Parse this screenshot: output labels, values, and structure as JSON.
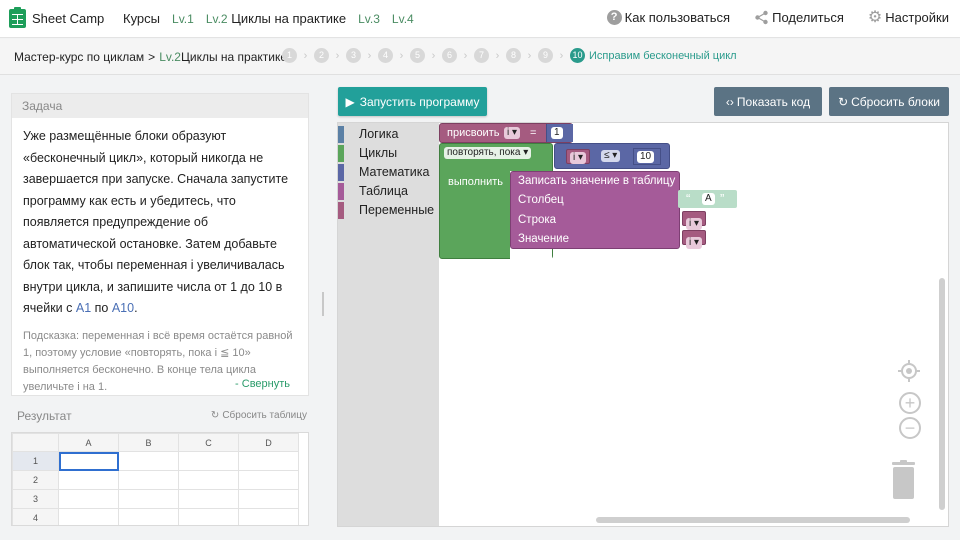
{
  "header": {
    "app_name": "Sheet Camp",
    "nav": {
      "courses": "Курсы",
      "items": [
        {
          "lv": "Lv.1",
          "label": ""
        },
        {
          "lv": "Lv.2",
          "label": "Циклы на практике"
        },
        {
          "lv": "Lv.3",
          "label": ""
        },
        {
          "lv": "Lv.4",
          "label": ""
        }
      ]
    },
    "actions": {
      "how_to": "Как пользоваться",
      "share": "Поделиться",
      "settings": "Настройки"
    }
  },
  "breadcrumb": {
    "course": "Мастер-курс по циклам",
    "separator": ">",
    "level": "Lv.2",
    "lesson": "Циклы на практике",
    "steps": [
      "1",
      "2",
      "3",
      "4",
      "5",
      "6",
      "7",
      "8",
      "9"
    ],
    "active_step": {
      "num": "10",
      "label": "Исправим бесконечный цикл"
    }
  },
  "task": {
    "title": "Задача",
    "text_parts": [
      "Уже размещённые блоки образуют «бесконечный цикл», который никогда не завершается при запуске. Сначала запустите программу как есть и убедитесь, что появляется предупреждение об автоматической остановке. Затем добавьте блок так, чтобы переменная i увеличивалась внутри цикла, и запишите числа от 1 до 10 в ячейки с ",
      "A1",
      " по ",
      "A10",
      "."
    ],
    "hint": "Подсказка: переменная i всё время остаётся равной 1, поэтому условие «повторять, пока i ≦ 10» выполняется бесконечно. В конце тела цикла увеличьте i на 1.",
    "collapse": "- Свернуть"
  },
  "result": {
    "title": "Результат",
    "reset_table": "Сбросить таблицу",
    "columns": [
      "A",
      "B",
      "C",
      "D"
    ],
    "rows": [
      "1",
      "2",
      "3",
      "4"
    ]
  },
  "buttons": {
    "run": "Запустить программу",
    "show_code": "Показать код",
    "reset_blocks": "Сбросить блоки"
  },
  "toolbox": {
    "categories": [
      "Логика",
      "Циклы",
      "Математика",
      "Таблица",
      "Переменные"
    ]
  },
  "blocks": {
    "assign": {
      "label": "присвоить",
      "var": "i",
      "op": "=",
      "value": "1"
    },
    "loop": {
      "mode": "повторять, пока",
      "var": "i",
      "cmp": "≤",
      "limit": "10",
      "do": "выполнить"
    },
    "write": {
      "title": "Записать значение в таблицу",
      "column": "Столбец",
      "row": "Строка",
      "value": "Значение",
      "col_text": "A",
      "row_var": "i",
      "value_var": "i"
    }
  },
  "colors": {
    "accent": "#22a09a",
    "secondary_button": "#5b7384",
    "logic": "#5b80a5",
    "loops": "#5ba55b",
    "math": "#5b67a5",
    "sheet": "#a55b99",
    "variables": "#a55b80"
  },
  "icons": [
    "help-icon",
    "share-icon",
    "gear-icon",
    "play-icon",
    "code-icon",
    "refresh-icon",
    "target-icon",
    "zoom-in-icon",
    "zoom-out-icon",
    "trash-icon"
  ]
}
